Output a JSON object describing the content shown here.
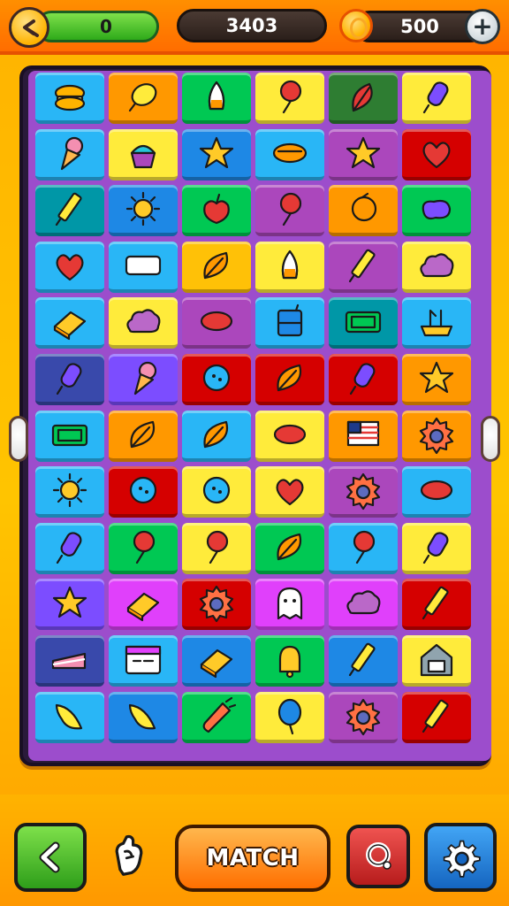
{
  "header": {
    "score_value": "0",
    "target_value": "3403",
    "coins_value": "500",
    "back_icon": "back-arrow-icon",
    "coin_icon": "coin-icon",
    "add_icon": "plus-icon",
    "add_label": "+"
  },
  "board": {
    "rows": 12,
    "columns": 6,
    "frame_color": "#2a1a3a",
    "tiles": [
      [
        {
          "item": "macaron",
          "bg": "#29b6f6"
        },
        {
          "item": "lemon",
          "bg": "#ff9800"
        },
        {
          "item": "candy-corn",
          "bg": "#00c853"
        },
        {
          "item": "lollipop",
          "bg": "#ffeb3b"
        },
        {
          "item": "red-leaf",
          "bg": "#2e7d32"
        },
        {
          "item": "popsicle",
          "bg": "#ffeb3b"
        }
      ],
      [
        {
          "item": "ice-cream-cone",
          "bg": "#29b6f6"
        },
        {
          "item": "cupcake",
          "bg": "#ffeb3b"
        },
        {
          "item": "star",
          "bg": "#1e88e5"
        },
        {
          "item": "bread",
          "bg": "#29b6f6"
        },
        {
          "item": "star",
          "bg": "#ab47bc"
        },
        {
          "item": "heart",
          "bg": "#d50000"
        }
      ],
      [
        {
          "item": "crayon",
          "bg": "#0097a7"
        },
        {
          "item": "sun",
          "bg": "#1e88e5"
        },
        {
          "item": "apple",
          "bg": "#00c853"
        },
        {
          "item": "lollipop",
          "bg": "#ab47bc"
        },
        {
          "item": "orange",
          "bg": "#ff9800"
        },
        {
          "item": "blob",
          "bg": "#00c853"
        }
      ],
      [
        {
          "item": "heart",
          "bg": "#29b6f6"
        },
        {
          "item": "bandage",
          "bg": "#29b6f6"
        },
        {
          "item": "leaf",
          "bg": "#ffc107"
        },
        {
          "item": "candy-corn",
          "bg": "#ffeb3b"
        },
        {
          "item": "crayon",
          "bg": "#ab47bc"
        },
        {
          "item": "cloud",
          "bg": "#ffeb3b"
        }
      ],
      [
        {
          "item": "butter",
          "bg": "#29b6f6"
        },
        {
          "item": "cloud",
          "bg": "#ffeb3b"
        },
        {
          "item": "bean",
          "bg": "#ab47bc"
        },
        {
          "item": "juice-box",
          "bg": "#29b6f6"
        },
        {
          "item": "ticket",
          "bg": "#0097a7"
        },
        {
          "item": "tray",
          "bg": "#29b6f6"
        }
      ],
      [
        {
          "item": "popsicle",
          "bg": "#3949ab"
        },
        {
          "item": "ice-cream-cone",
          "bg": "#7c4dff"
        },
        {
          "item": "button",
          "bg": "#d50000"
        },
        {
          "item": "leaf",
          "bg": "#d50000"
        },
        {
          "item": "popsicle",
          "bg": "#d50000"
        },
        {
          "item": "star",
          "bg": "#ff9800"
        }
      ],
      [
        {
          "item": "ticket",
          "bg": "#29b6f6"
        },
        {
          "item": "leaf",
          "bg": "#ff9800"
        },
        {
          "item": "leaf",
          "bg": "#29b6f6"
        },
        {
          "item": "bean",
          "bg": "#ffeb3b"
        },
        {
          "item": "flag",
          "bg": "#ff9800"
        },
        {
          "item": "gear",
          "bg": "#ff9800"
        }
      ],
      [
        {
          "item": "sun",
          "bg": "#29b6f6"
        },
        {
          "item": "button",
          "bg": "#d50000"
        },
        {
          "item": "button",
          "bg": "#ffeb3b"
        },
        {
          "item": "heart",
          "bg": "#ffeb3b"
        },
        {
          "item": "gear",
          "bg": "#ab47bc"
        },
        {
          "item": "bean",
          "bg": "#29b6f6"
        }
      ],
      [
        {
          "item": "popsicle",
          "bg": "#29b6f6"
        },
        {
          "item": "lollipop",
          "bg": "#00c853"
        },
        {
          "item": "lollipop",
          "bg": "#ffeb3b"
        },
        {
          "item": "leaf",
          "bg": "#00c853"
        },
        {
          "item": "lollipop",
          "bg": "#29b6f6"
        },
        {
          "item": "popsicle",
          "bg": "#ffeb3b"
        }
      ],
      [
        {
          "item": "star",
          "bg": "#7c4dff"
        },
        {
          "item": "butter",
          "bg": "#e040fb"
        },
        {
          "item": "gear",
          "bg": "#d50000"
        },
        {
          "item": "ghost",
          "bg": "#e040fb"
        },
        {
          "item": "cloud",
          "bg": "#e040fb"
        },
        {
          "item": "crayon",
          "bg": "#d50000"
        }
      ],
      [
        {
          "item": "cake",
          "bg": "#3949ab"
        },
        {
          "item": "calendar",
          "bg": "#29b6f6"
        },
        {
          "item": "butter",
          "bg": "#1e88e5"
        },
        {
          "item": "bell",
          "bg": "#00c853"
        },
        {
          "item": "crayon",
          "bg": "#1e88e5"
        },
        {
          "item": "house",
          "bg": "#ffeb3b"
        }
      ],
      [
        {
          "item": "banana",
          "bg": "#29b6f6"
        },
        {
          "item": "banana",
          "bg": "#1e88e5"
        },
        {
          "item": "carrot",
          "bg": "#00c853"
        },
        {
          "item": "balloon",
          "bg": "#ffeb3b"
        },
        {
          "item": "gear",
          "bg": "#ab47bc"
        },
        {
          "item": "crayon",
          "bg": "#d50000"
        }
      ]
    ]
  },
  "footer": {
    "back_icon": "back-chevron-icon",
    "hint_icon": "hint-hand-icon",
    "match_label": "MATCH",
    "replay_icon": "replay-icon",
    "settings_icon": "gear-icon"
  }
}
